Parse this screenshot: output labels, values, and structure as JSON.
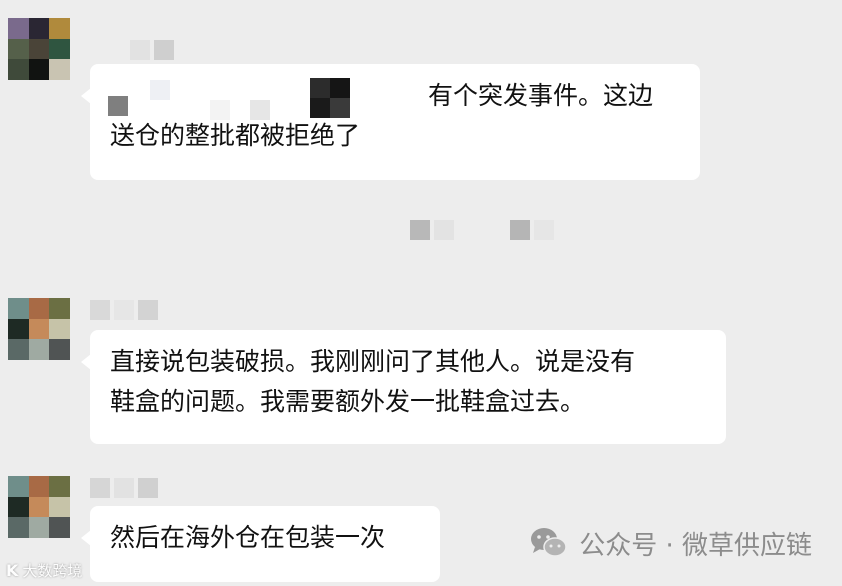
{
  "messages": [
    {
      "lines": [
        "有个突发事件。这边",
        "送仓的整批都被拒绝了"
      ]
    },
    {
      "lines": [
        "直接说包装破损。我刚刚问了其他人。说是没有",
        "鞋盒的问题。我需要额外发一批鞋盒过去。"
      ]
    },
    {
      "lines": [
        "然后在海外仓在包装一次"
      ]
    }
  ],
  "watermark": {
    "text": "公众号 · 微草供应链",
    "icon": "wechat-icon"
  },
  "corner_mark": {
    "text": "大数跨境"
  },
  "colors": {
    "background": "#ededed",
    "bubble": "#ffffff",
    "text": "#111111",
    "watermark": "#8c8c8c"
  }
}
